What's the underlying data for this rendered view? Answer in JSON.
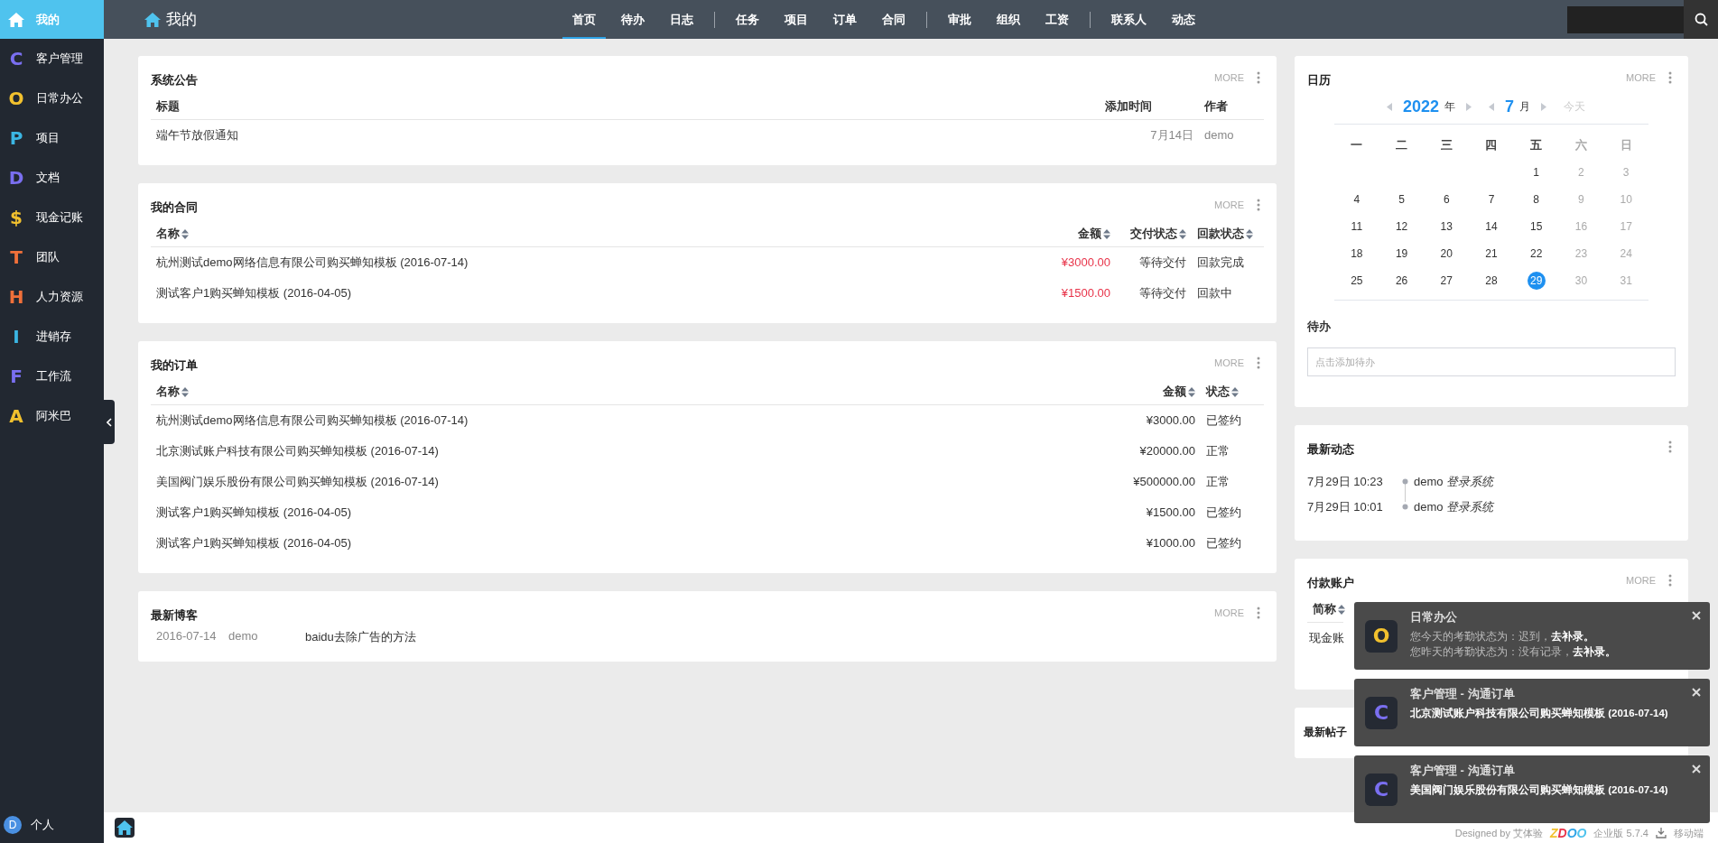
{
  "sidebar": {
    "items": [
      {
        "kind": "home",
        "label": "我的",
        "selected": true
      },
      {
        "letter": "C",
        "label": "客户管理",
        "color": "#7a6ff0",
        "selected": false
      },
      {
        "letter": "O",
        "label": "日常办公",
        "color": "#f2c12e",
        "selected": false
      },
      {
        "letter": "P",
        "label": "项目",
        "color": "#3bb6e3",
        "selected": false
      },
      {
        "letter": "D",
        "label": "文档",
        "color": "#7a6ff0",
        "selected": false
      },
      {
        "letter": "$",
        "label": "现金记账",
        "color": "#f2c12e",
        "selected": false
      },
      {
        "letter": "T",
        "label": "团队",
        "color": "#f0703a",
        "selected": false
      },
      {
        "letter": "H",
        "label": "人力资源",
        "color": "#f0703a",
        "selected": false
      },
      {
        "letter": "I",
        "label": "进销存",
        "color": "#3bb6e3",
        "selected": false
      },
      {
        "letter": "F",
        "label": "工作流",
        "color": "#7a6ff0",
        "selected": false
      },
      {
        "letter": "A",
        "label": "阿米巴",
        "color": "#f2c12e",
        "selected": false
      }
    ],
    "user": {
      "initial": "D",
      "label": "个人"
    }
  },
  "topbar": {
    "title": "我的",
    "nav": [
      {
        "items": [
          {
            "label": "首页",
            "selected": true
          },
          {
            "label": "待办",
            "selected": false
          },
          {
            "label": "日志",
            "selected": false
          }
        ]
      },
      {
        "items": [
          {
            "label": "任务",
            "selected": false
          },
          {
            "label": "项目",
            "selected": false
          },
          {
            "label": "订单",
            "selected": false
          },
          {
            "label": "合同",
            "selected": false
          }
        ]
      },
      {
        "items": [
          {
            "label": "审批",
            "selected": false
          },
          {
            "label": "组织",
            "selected": false
          },
          {
            "label": "工资",
            "selected": false
          }
        ]
      },
      {
        "items": [
          {
            "label": "联系人",
            "selected": false
          },
          {
            "label": "动态",
            "selected": false
          }
        ]
      }
    ]
  },
  "announcements": {
    "title": "系统公告",
    "more": "MORE",
    "columns": [
      "标题",
      "添加时间",
      "作者"
    ],
    "rows": [
      [
        "端午节放假通知",
        "7月14日",
        "demo"
      ]
    ]
  },
  "contracts": {
    "title": "我的合同",
    "more": "MORE",
    "columns": [
      "名称",
      "金额",
      "交付状态",
      "回款状态"
    ],
    "rows": [
      [
        "杭州测试demo网络信息有限公司购买蝉知模板 (2016-07-14)",
        "¥3000.00",
        "等待交付",
        "回款完成"
      ],
      [
        "测试客户1购买蝉知模板 (2016-04-05)",
        "¥1500.00",
        "等待交付",
        "回款中"
      ]
    ]
  },
  "orders": {
    "title": "我的订单",
    "more": "MORE",
    "columns": [
      "名称",
      "金额",
      "状态"
    ],
    "rows": [
      [
        "杭州测试demo网络信息有限公司购买蝉知模板 (2016-07-14)",
        "¥3000.00",
        "已签约"
      ],
      [
        "北京测试账户科技有限公司购买蝉知模板 (2016-07-14)",
        "¥20000.00",
        "正常"
      ],
      [
        "美国阀门娱乐股份有限公司购买蝉知模板 (2016-07-14)",
        "¥500000.00",
        "正常"
      ],
      [
        "测试客户1购买蝉知模板 (2016-04-05)",
        "¥1500.00",
        "已签约"
      ],
      [
        "测试客户1购买蝉知模板 (2016-04-05)",
        "¥1000.00",
        "已签约"
      ]
    ]
  },
  "blogs": {
    "title": "最新博客",
    "more": "MORE",
    "rows": [
      [
        "2016-07-14",
        "demo",
        "baidu去除广告的方法"
      ]
    ]
  },
  "calendar": {
    "title": "日历",
    "more": "MORE",
    "year": "2022",
    "year_unit": "年",
    "month": "7",
    "month_unit": "月",
    "today": "今天",
    "weekdays": [
      {
        "label": "一",
        "muted": false
      },
      {
        "label": "二",
        "muted": false
      },
      {
        "label": "三",
        "muted": false
      },
      {
        "label": "四",
        "muted": false
      },
      {
        "label": "五",
        "muted": false
      },
      {
        "label": "六",
        "muted": true
      },
      {
        "label": "日",
        "muted": true
      }
    ],
    "weeks": [
      [
        {
          "day": "1",
          "muted": false,
          "selected": false
        },
        {
          "day": "2",
          "muted": true,
          "selected": false
        },
        {
          "day": "3",
          "muted": true,
          "selected": false
        }
      ],
      [
        {
          "day": "4",
          "muted": false,
          "selected": false
        },
        {
          "day": "5",
          "muted": false,
          "selected": false
        },
        {
          "day": "6",
          "muted": false,
          "selected": false
        },
        {
          "day": "7",
          "muted": false,
          "selected": false
        },
        {
          "day": "8",
          "muted": false,
          "selected": false
        },
        {
          "day": "9",
          "muted": true,
          "selected": false
        },
        {
          "day": "10",
          "muted": true,
          "selected": false
        }
      ],
      [
        {
          "day": "11",
          "muted": false,
          "selected": false
        },
        {
          "day": "12",
          "muted": false,
          "selected": false
        },
        {
          "day": "13",
          "muted": false,
          "selected": false
        },
        {
          "day": "14",
          "muted": false,
          "selected": false
        },
        {
          "day": "15",
          "muted": false,
          "selected": false
        },
        {
          "day": "16",
          "muted": true,
          "selected": false
        },
        {
          "day": "17",
          "muted": true,
          "selected": false
        }
      ],
      [
        {
          "day": "18",
          "muted": false,
          "selected": false
        },
        {
          "day": "19",
          "muted": false,
          "selected": false
        },
        {
          "day": "20",
          "muted": false,
          "selected": false
        },
        {
          "day": "21",
          "muted": false,
          "selected": false
        },
        {
          "day": "22",
          "muted": false,
          "selected": false
        },
        {
          "day": "23",
          "muted": true,
          "selected": false
        },
        {
          "day": "24",
          "muted": true,
          "selected": false
        }
      ],
      [
        {
          "day": "25",
          "muted": false,
          "selected": false
        },
        {
          "day": "26",
          "muted": false,
          "selected": false
        },
        {
          "day": "27",
          "muted": false,
          "selected": false
        },
        {
          "day": "28",
          "muted": false,
          "selected": false
        },
        {
          "day": "29",
          "muted": false,
          "selected": true
        },
        {
          "day": "30",
          "muted": true,
          "selected": false
        },
        {
          "day": "31",
          "muted": true,
          "selected": false
        }
      ]
    ],
    "todo": {
      "title": "待办",
      "placeholder": "点击添加待办"
    }
  },
  "activity": {
    "title": "最新动态",
    "items": [
      {
        "time": "7月29日 10:23",
        "user": "demo",
        "action": "登录系统"
      },
      {
        "time": "7月29日 10:01",
        "user": "demo",
        "action": "登录系统"
      }
    ]
  },
  "accounts": {
    "title": "付款账户",
    "more": "MORE",
    "column": "简称",
    "cell": "现金账"
  },
  "posts": {
    "title": "最新帖子"
  },
  "footer": {
    "designed": "Designed by 艾体验",
    "logo": [
      "Z",
      "D",
      "O",
      "O"
    ],
    "edition": "企业版 5.7.4",
    "mobile": "移动端"
  },
  "notifications": [
    {
      "letter": "O",
      "color": "#f2c12e",
      "title": "日常办公",
      "kind": "attendance",
      "lines": [
        "您今天的考勤状态为：迟到，**去补录。**",
        "您昨天的考勤状态为：没有记录，**去补录。**"
      ]
    },
    {
      "letter": "C",
      "color": "#7a6ff0",
      "title": "客户管理 - 沟通订单",
      "kind": "order",
      "lines": [
        "北京测试账户科技有限公司购买蝉知模板 (2016-07-14)"
      ]
    },
    {
      "letter": "C",
      "color": "#7a6ff0",
      "title": "客户管理 - 沟通订单",
      "kind": "order",
      "lines": [
        "美国阀门娱乐股份有限公司购买蝉知模板 (2016-07-14)"
      ]
    }
  ]
}
